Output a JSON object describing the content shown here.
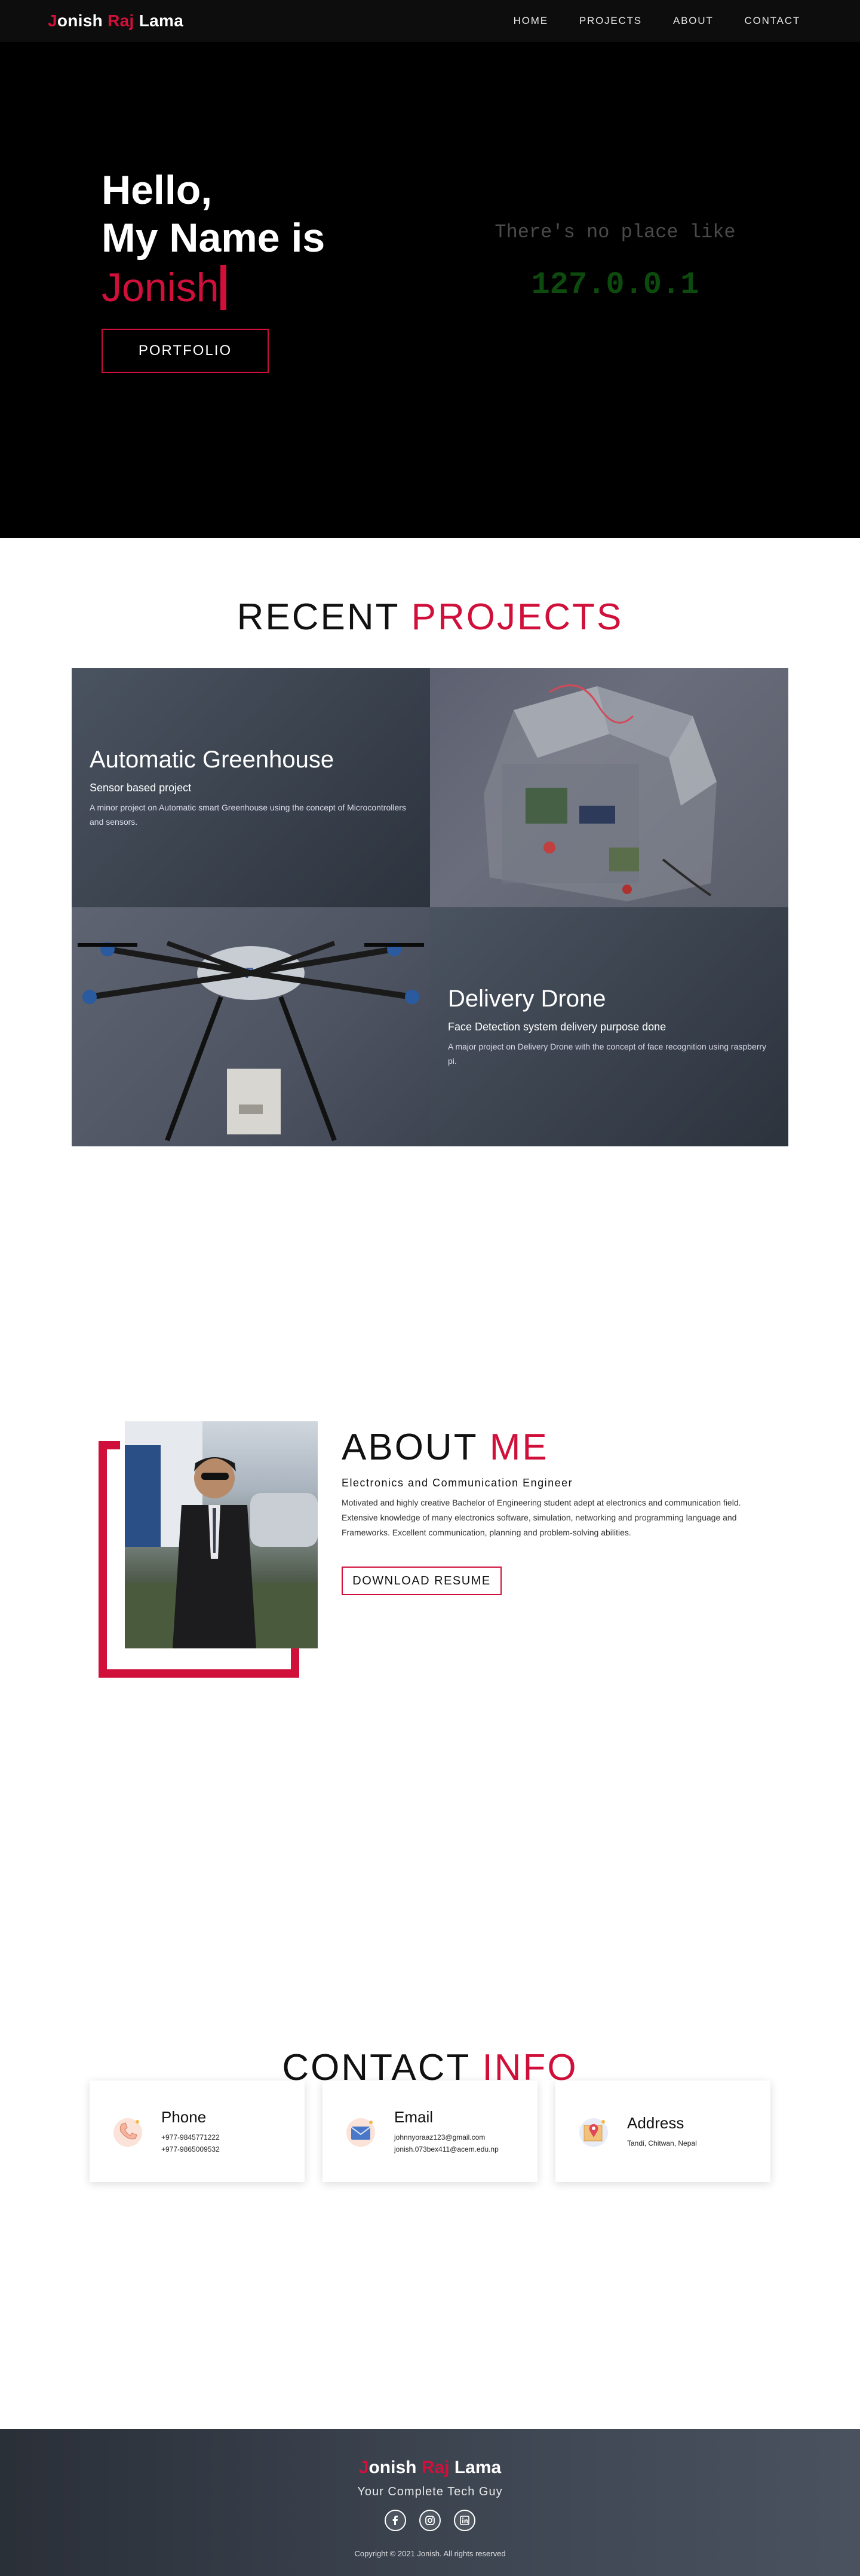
{
  "nav": {
    "brand_first_letter": "J",
    "brand_first_rest": "onish",
    "brand_middle": "Raj",
    "brand_last": "Lama",
    "links": [
      "HOME",
      "PROJECTS",
      "ABOUT",
      "CONTACT"
    ]
  },
  "hero": {
    "line1": "Hello,",
    "line2": "My Name is",
    "typed_name": "Jonish",
    "button_label": "PORTFOLIO",
    "quote_line1": "There's no place like",
    "quote_line2": "127.0.0.1"
  },
  "projects": {
    "title_main": "RECENT",
    "title_accent": "PROJECTS",
    "items": [
      {
        "title": "Automatic Greenhouse",
        "subtitle": "Sensor based project",
        "description": "A minor project on Automatic smart Greenhouse using the concept of Microcontrollers and sensors."
      },
      {
        "title": "Delivery Drone",
        "subtitle": "Face Detection system delivery purpose done",
        "description": "A major project on Delivery Drone with the concept of face recognition using raspberry pi."
      }
    ]
  },
  "about": {
    "title_main": "ABOUT",
    "title_accent": "ME",
    "role": "Electronics and Communication Engineer",
    "description": "Motivated and highly creative Bachelor of Engineering student adept at electronics and communication field. Extensive knowledge of many electronics software, simulation, networking and programming language and Frameworks. Excellent communication, planning and problem-solving abilities.",
    "button_label": "DOWNLOAD RESUME"
  },
  "contact": {
    "title_main": "CONTACT",
    "title_accent": "INFO",
    "cards": [
      {
        "icon": "phone-icon",
        "title": "Phone",
        "lines": [
          "+977-9845771222",
          "+977-9865009532"
        ]
      },
      {
        "icon": "email-icon",
        "title": "Email",
        "lines": [
          "johnnyoraaz123@gmail.com",
          "jonish.073bex411@acem.edu.np"
        ]
      },
      {
        "icon": "address-icon",
        "title": "Address",
        "lines": [
          "Tandi, Chitwan, Nepal"
        ]
      }
    ]
  },
  "footer": {
    "brand_first_letter": "J",
    "brand_first_rest": "onish",
    "brand_middle": "Raj",
    "brand_last": "Lama",
    "tagline": "Your Complete Tech Guy",
    "socials": [
      "facebook-icon",
      "instagram-icon",
      "linkedin-icon"
    ],
    "copyright": "Copyright © 2021 Jonish. All rights reserved"
  },
  "colors": {
    "accent": "#d0103a",
    "nav_bg": "#0d0d0d",
    "hero_bg": "#000000",
    "project_text_bg": "#3a424d",
    "terminal_green": "#0d4a0d"
  }
}
